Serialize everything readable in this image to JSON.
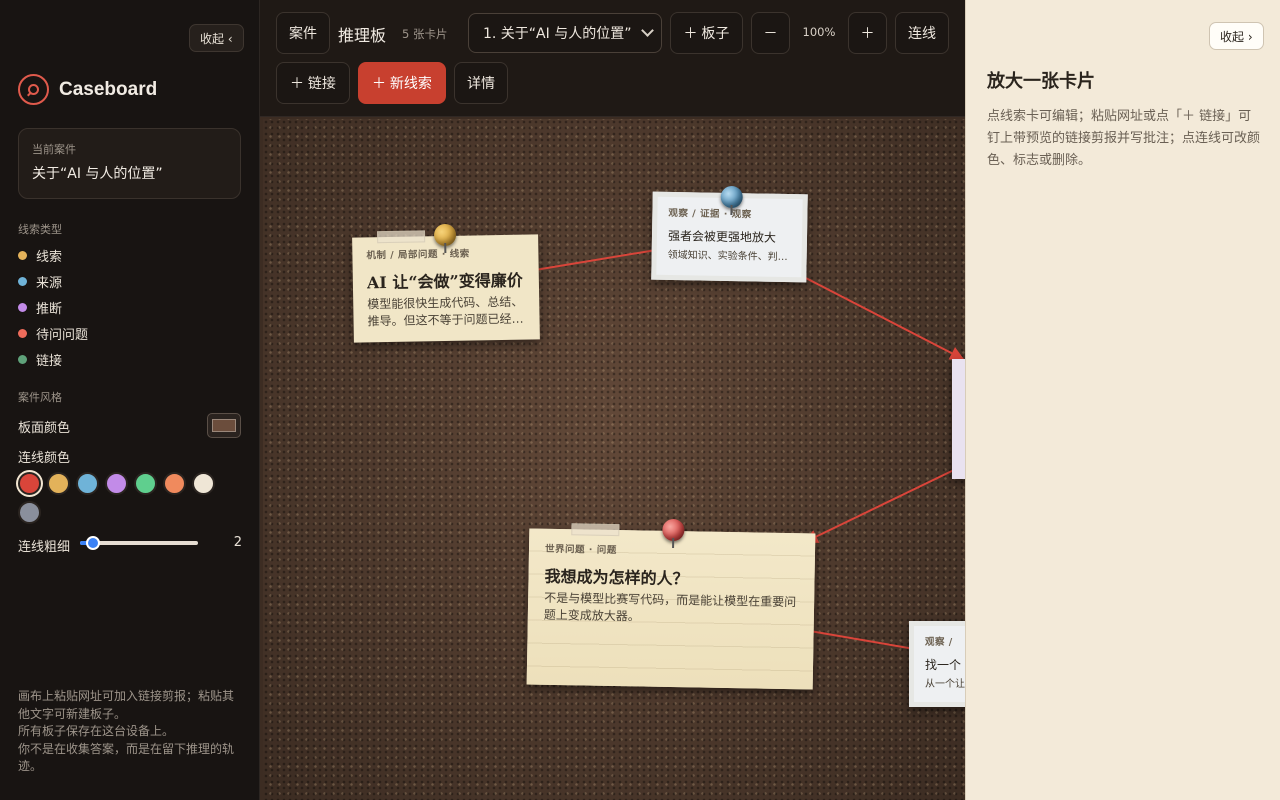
{
  "sidebar": {
    "collapse_label": "收起 ‹",
    "brand": "Caseboard",
    "current_case_label": "当前案件",
    "current_case_value": "关于“AI 与人的位置”",
    "clue_types_title": "线索类型",
    "clue_types": [
      {
        "label": "线索",
        "color": "#e3b25a"
      },
      {
        "label": "来源",
        "color": "#6fb3d8"
      },
      {
        "label": "推断",
        "color": "#c28be8"
      },
      {
        "label": "待问问题",
        "color": "#ef6c5b"
      },
      {
        "label": "链接",
        "color": "#5fa27a"
      }
    ],
    "style_title": "案件风格",
    "board_color_label": "板面颜色",
    "board_color": "#6b4d3c",
    "line_color_label": "连线颜色",
    "line_colors": [
      "#d9453a",
      "#e3b25a",
      "#6fb3d8",
      "#c28be8",
      "#5fcf8e",
      "#f08a5d",
      "#efe6d6",
      "#8a8f9c"
    ],
    "selected_line_color": "#d9453a",
    "line_width_label": "连线粗细",
    "line_width": 2,
    "line_width_min": 1,
    "line_width_max": 10,
    "footer_lines": [
      "画布上粘贴网址可加入链接剪报；粘贴其他文字可新建板子。",
      "所有板子保存在这台设备上。",
      "你不是在收集答案，而是在留下推理的轨迹。"
    ]
  },
  "toolbar": {
    "case_btn": "案件",
    "title": "推理板",
    "card_count": "5 张卡片",
    "board_select": "1. 关于“AI 与人的位置”",
    "add_board": "＋ 板子",
    "zoom_out": "－",
    "zoom": "100%",
    "zoom_in": "＋",
    "connect": "连线",
    "add_link": "＋ 链接",
    "new_clue": "＋ 新线索",
    "details": "详情"
  },
  "cards": [
    {
      "tags": "机制 / 局部问题 · 线索",
      "title": "AI 让“会做”变得廉价",
      "body": "模型能很快生成代码、总结、推导。但这不等于问题已经…",
      "pin": "#d9a43a"
    },
    {
      "tags": "观察 / 证据 · 观察",
      "title": "强者会被更强地放大",
      "body": "领域知识、实验条件、判…",
      "pin": "#4f8fb8"
    },
    {
      "tags": "世界问题 · 问题",
      "title": "我想成为怎样的人？",
      "body": "不是与模型比赛写代码，而是能让模型在重要问题上变成放大器。",
      "pin": "#d94a48"
    },
    {
      "tags": "观察 /",
      "title": "找一个",
      "body": "从一个让",
      "pin": ""
    }
  ],
  "connection_color": "#d9453a",
  "panel": {
    "collapse_label": "收起 ›",
    "title": "放大一张卡片",
    "text": "点线索卡可编辑；粘贴网址或点「＋ 链接」可钉上带预览的链接剪报并写批注；点连线可改颜色、标志或删除。"
  }
}
